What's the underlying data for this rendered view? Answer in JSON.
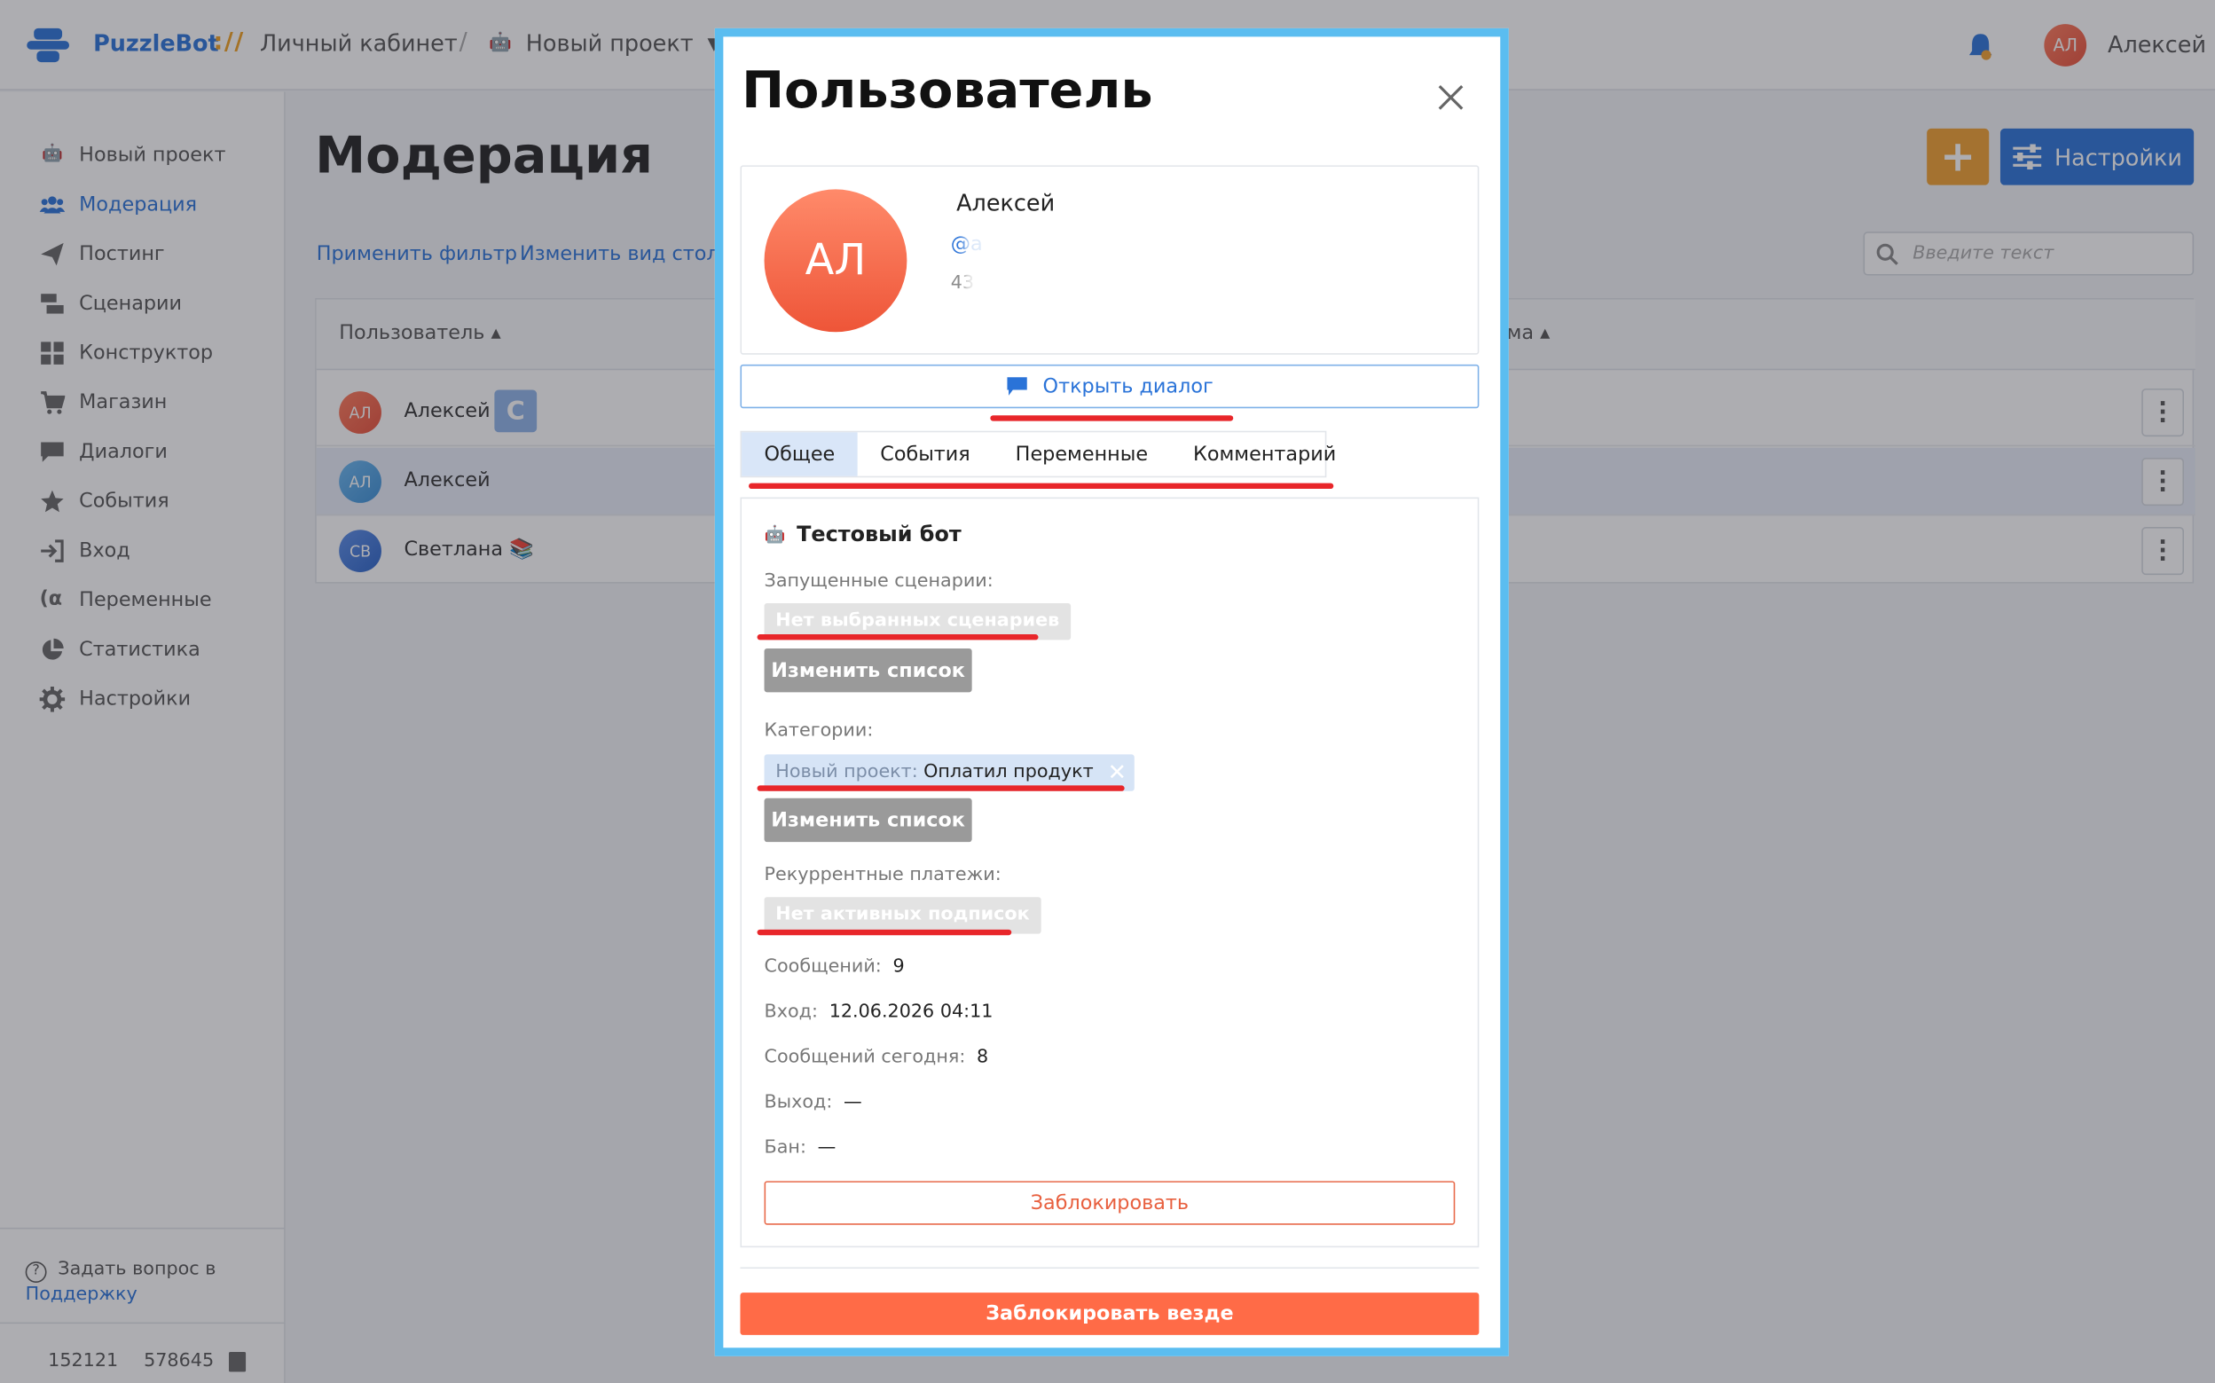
{
  "header": {
    "brand": "PuzzleBot",
    "brand_sep": "://",
    "cabinet": "Личный кабинет",
    "slash": "/",
    "project": "Новый проект",
    "user_initials": "АЛ",
    "user_name": "Алексей"
  },
  "sidebar": {
    "items": [
      {
        "label": "Новый проект",
        "icon": "bot-icon"
      },
      {
        "label": "Модерация",
        "icon": "users-icon"
      },
      {
        "label": "Постинг",
        "icon": "paper-plane-icon"
      },
      {
        "label": "Сценарии",
        "icon": "scenarios-icon"
      },
      {
        "label": "Конструктор",
        "icon": "grid-icon"
      },
      {
        "label": "Магазин",
        "icon": "cart-icon"
      },
      {
        "label": "Диалоги",
        "icon": "chat-icon"
      },
      {
        "label": "События",
        "icon": "star-icon"
      },
      {
        "label": "Вход",
        "icon": "login-icon"
      },
      {
        "label": "Переменные",
        "icon": "variable-icon"
      },
      {
        "label": "Статистика",
        "icon": "pie-chart-icon"
      },
      {
        "label": "Настройки",
        "icon": "gear-icon"
      }
    ],
    "help_text": "Задать вопрос в",
    "help_link": "Поддержку",
    "id_1": "152121",
    "id_2": "578645"
  },
  "main": {
    "title": "Модерация",
    "apply_filter": "Применить фильтр",
    "change_view": "Изменить вид столбцов",
    "settings_label": "Настройки",
    "plus_label": "+",
    "search_placeholder": "Введите текст",
    "columns": {
      "user": "Пользователь ▴",
      "right": "ома ▴"
    },
    "rows": [
      {
        "initials": "АЛ",
        "name": "Алексей",
        "badge": "С"
      },
      {
        "initials": "АЛ",
        "name": "Алексей"
      },
      {
        "initials": "СВ",
        "name": "Светлана 📚"
      }
    ]
  },
  "modal": {
    "title": "Пользователь",
    "initials": "АЛ",
    "name": "Алексей",
    "handle": "@a",
    "user_id": "43",
    "open_dialog": "Открыть диалог",
    "tabs": [
      "Общее",
      "События",
      "Переменные",
      "Комментарий"
    ],
    "bot_name": "Тестовый бот",
    "scenarios_label": "Запущенные сценарии:",
    "scenarios_value": "Нет выбранных сценариев",
    "change_list": "Изменить список",
    "categories_label": "Категории:",
    "category_prefix": "Новый проект:",
    "category_value": "Оплатил продукт",
    "recurrent_label": "Рекуррентные платежи:",
    "recurrent_value": "Нет активных подписок",
    "stats": [
      {
        "label": "Сообщений:",
        "value": "9"
      },
      {
        "label": "Вход:",
        "value": "12.06.2026 04:11"
      },
      {
        "label": "Сообщений сегодня:",
        "value": "8"
      },
      {
        "label": "Выход:",
        "value": "—"
      },
      {
        "label": "Бан:",
        "value": "—"
      }
    ],
    "block": "Заблокировать",
    "block_all": "Заблокировать везде"
  },
  "colors": {
    "accent": "#2a73d8",
    "danger": "#ff6b47",
    "modal_border": "#5bbdf0",
    "orange": "#f0a030"
  }
}
